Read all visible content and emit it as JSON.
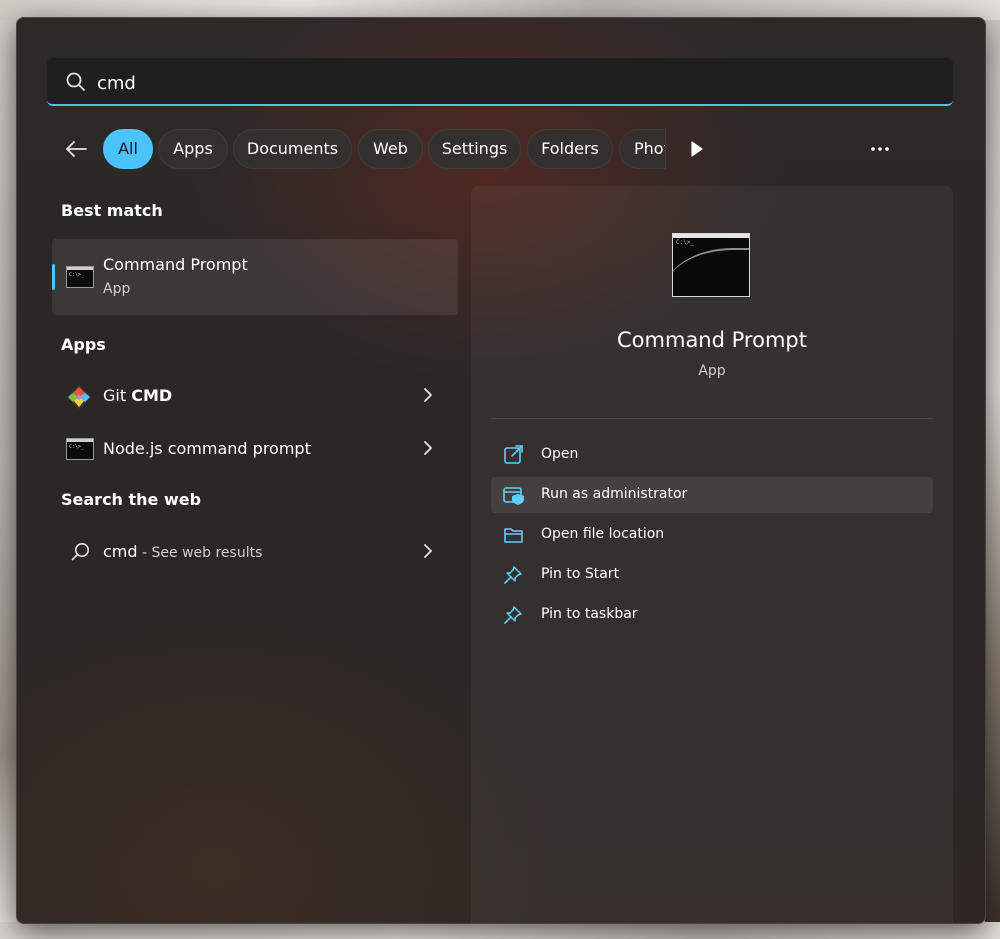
{
  "search": {
    "value": "cmd"
  },
  "filters": [
    {
      "label": "All",
      "active": true
    },
    {
      "label": "Apps"
    },
    {
      "label": "Documents"
    },
    {
      "label": "Web"
    },
    {
      "label": "Settings"
    },
    {
      "label": "Folders"
    },
    {
      "label": "Phot"
    }
  ],
  "best_match": {
    "section": "Best match",
    "title": "Command Prompt",
    "subtitle": "App"
  },
  "apps": {
    "section": "Apps",
    "items": [
      {
        "prefix": "Git ",
        "bold": "CMD",
        "icon": "git-icon"
      },
      {
        "label": "Node.js command prompt",
        "icon": "terminal-icon"
      }
    ]
  },
  "web": {
    "section": "Search the web",
    "query": "cmd",
    "suffix": " - See web results"
  },
  "details": {
    "title": "Command Prompt",
    "subtitle": "App",
    "actions": [
      {
        "label": "Open",
        "icon": "open-external-icon"
      },
      {
        "label": "Run as administrator",
        "icon": "admin-shield-icon",
        "hover": true
      },
      {
        "label": "Open file location",
        "icon": "folder-icon"
      },
      {
        "label": "Pin to Start",
        "icon": "pin-icon"
      },
      {
        "label": "Pin to taskbar",
        "icon": "pin-icon"
      }
    ]
  },
  "colors": {
    "accent": "#4cc2ff",
    "panel": "#2c2a29",
    "icon_blue": "#60cdff"
  },
  "console_glyph": "C:\\>_"
}
